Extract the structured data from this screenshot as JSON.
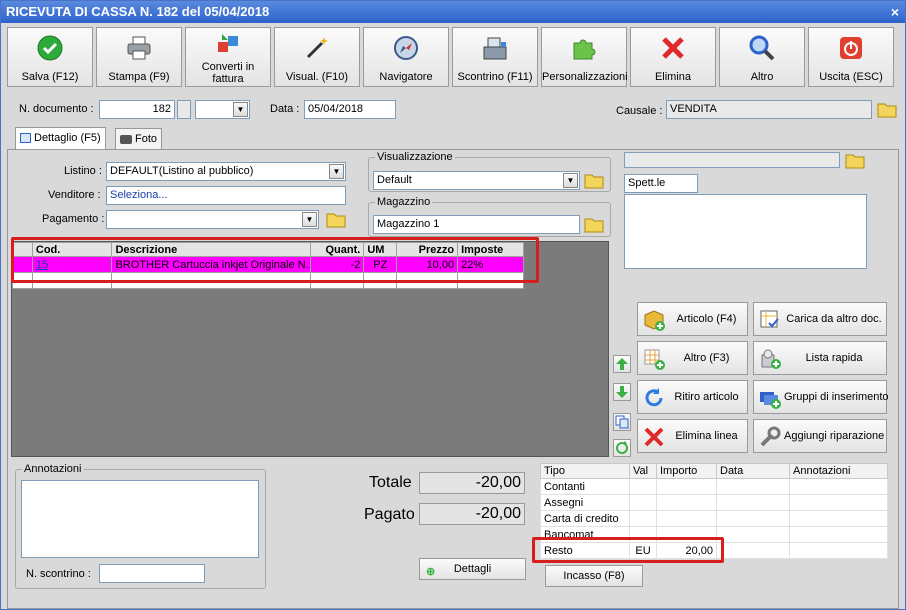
{
  "window": {
    "title": "RICEVUTA DI CASSA N. 182 del 05/04/2018",
    "close": "×"
  },
  "toolbar": [
    {
      "label": "Salva (F12)",
      "icon": "check-icon"
    },
    {
      "label": "Stampa (F9)",
      "icon": "printer-icon"
    },
    {
      "label": "Converti in fattura",
      "icon": "convert-icon"
    },
    {
      "label": "Visual. (F10)",
      "icon": "magic-wand-icon"
    },
    {
      "label": "Navigatore",
      "icon": "compass-icon"
    },
    {
      "label": "Scontrino (F11)",
      "icon": "cash-register-icon"
    },
    {
      "label": "Personalizzazioni",
      "icon": "puzzle-icon"
    },
    {
      "label": "Elimina",
      "icon": "delete-x-icon"
    },
    {
      "label": "Altro",
      "icon": "magnifier-icon"
    },
    {
      "label": "Uscita (ESC)",
      "icon": "power-icon"
    }
  ],
  "header": {
    "doc_label": "N. documento :",
    "doc_number": "182",
    "suffix": "",
    "date_label": "Data :",
    "date": "05/04/2018",
    "causale_label": "Causale :",
    "causale": "VENDITA"
  },
  "tabs": [
    {
      "label": "Dettaglio (F5)"
    },
    {
      "label": "Foto"
    }
  ],
  "form": {
    "listino_label": "Listino :",
    "listino": "DEFAULT(Listino al pubblico)",
    "venditore_label": "Venditore :",
    "venditore": "Seleziona...",
    "pagamento_label": "Pagamento :",
    "pagamento": "",
    "visualizzazione_label": "Visualizzazione",
    "visualizzazione": "Default",
    "magazzino_label": "Magazzino",
    "magazzino": "Magazzino 1",
    "customer_top": "",
    "spett": "Spett.le"
  },
  "grid": {
    "columns": [
      "",
      "Cod.",
      "Descrizione",
      "Quant.",
      "UM",
      "Prezzo",
      "Imposte"
    ],
    "rows": [
      {
        "cod": "15",
        "descrizione": "BROTHER Cartuccia inkjet Originale N...",
        "quant": "-2",
        "um": "PZ",
        "prezzo": "10,00",
        "imposte": "22%"
      }
    ]
  },
  "actions": [
    {
      "label": "Articolo (F4)",
      "icon": "box-add-icon"
    },
    {
      "label": "Carica da altro doc.",
      "icon": "doc-check-icon"
    },
    {
      "label": "Altro (F3)",
      "icon": "grid-add-icon"
    },
    {
      "label": "Lista rapida",
      "icon": "list-rapid-icon"
    },
    {
      "label": "Ritiro articolo",
      "icon": "return-arrow-icon"
    },
    {
      "label": "Gruppi di inserimento",
      "icon": "group-add-icon"
    },
    {
      "label": "Elimina linea",
      "icon": "delete-line-icon"
    },
    {
      "label": "Aggiungi riparazione",
      "icon": "wrench-icon"
    }
  ],
  "notes": {
    "label": "Annotazioni",
    "scontrino_label": "N. scontrino :",
    "scontrino": ""
  },
  "totals": {
    "totale_label": "Totale",
    "totale": "-20,00",
    "pagato_label": "Pagato",
    "pagato": "-20,00",
    "dettagli": "Dettagli"
  },
  "payments": {
    "columns": [
      "Tipo",
      "Val",
      "Importo",
      "Data",
      "Annotazioni"
    ],
    "rows": [
      {
        "tipo": "Contanti",
        "val": "",
        "importo": ""
      },
      {
        "tipo": "Assegni",
        "val": "",
        "importo": ""
      },
      {
        "tipo": "Carta di credito",
        "val": "",
        "importo": ""
      },
      {
        "tipo": "Bancomat",
        "val": "",
        "importo": ""
      },
      {
        "tipo": "Resto",
        "val": "EU",
        "importo": "20,00"
      }
    ],
    "incasso": "Incasso (F8)"
  },
  "colors": {
    "highlight_row": "#ff00ff",
    "annotation_box": "#d81d1d",
    "title_bar": "#2c62c9"
  }
}
